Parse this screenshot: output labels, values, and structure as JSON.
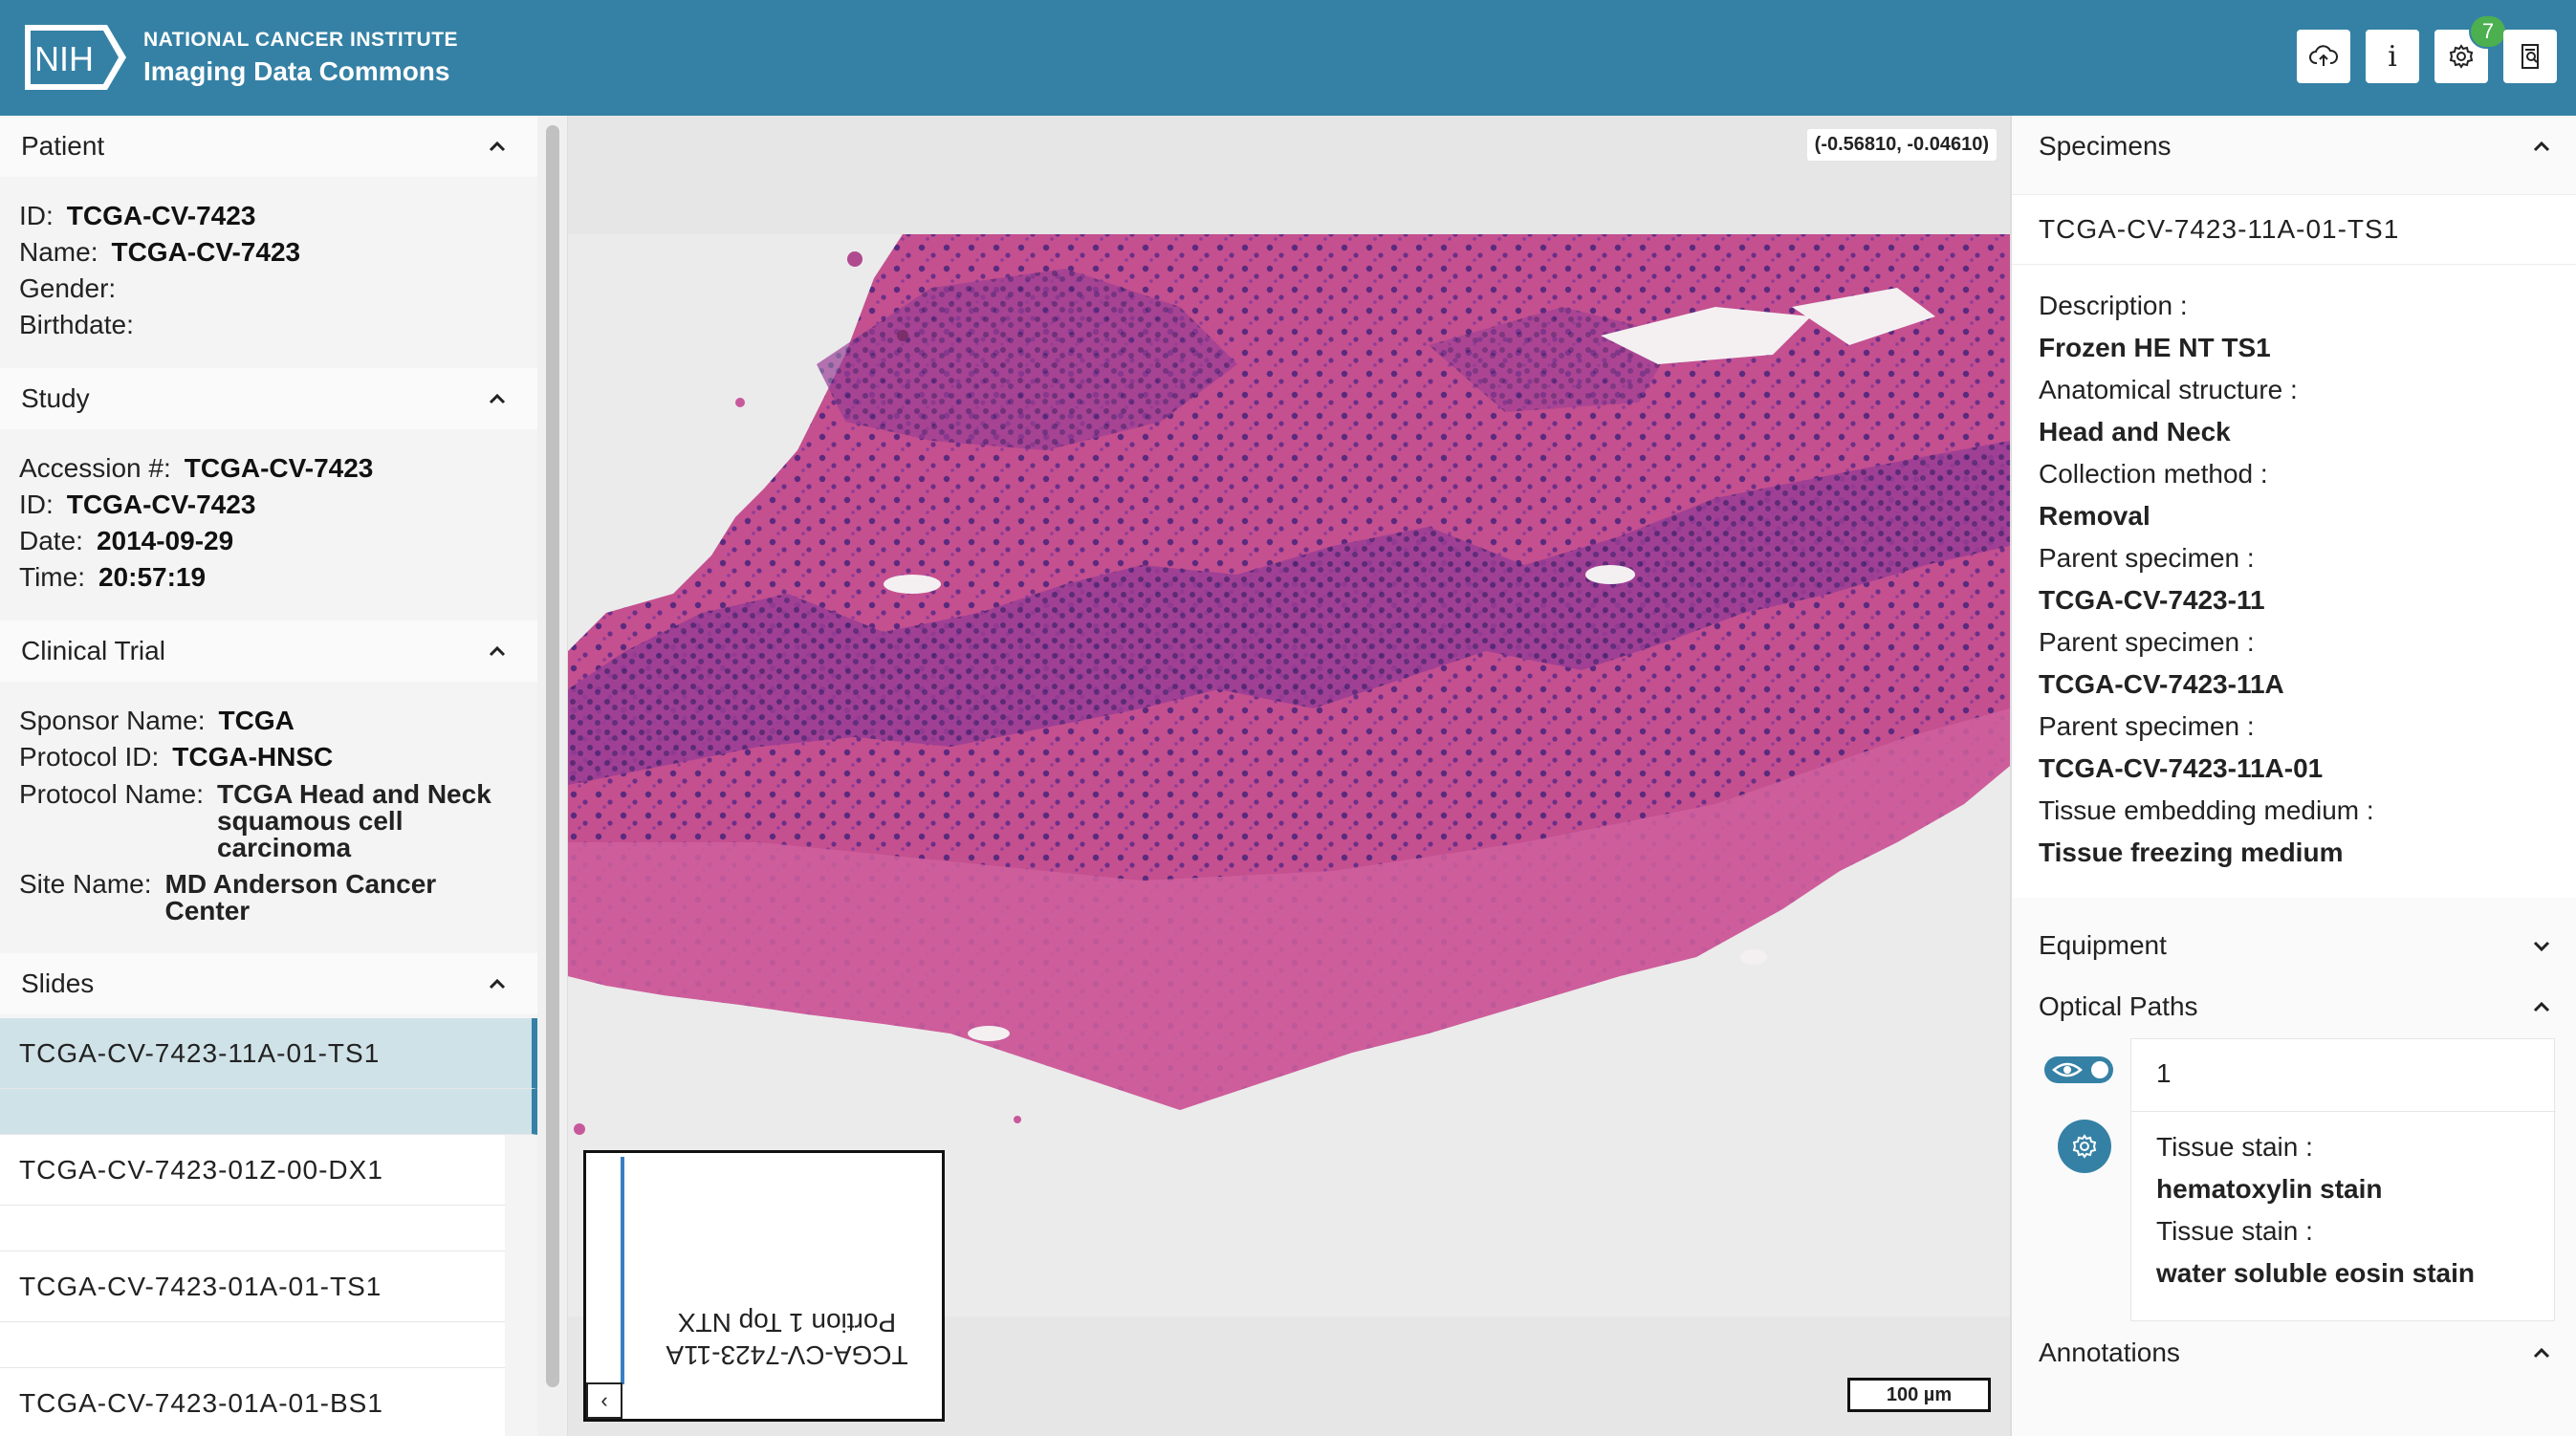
{
  "header": {
    "logo_text": "NIH",
    "org": "NATIONAL CANCER INSTITUTE",
    "app": "Imaging Data Commons",
    "badge_count": "7",
    "info_label": "i",
    "colors": {
      "brand": "#3581a5",
      "badge": "#4caf50"
    }
  },
  "patient": {
    "title": "Patient",
    "id_label": "ID",
    "id": "TCGA-CV-7423",
    "name_label": "Name",
    "name": "TCGA-CV-7423",
    "gender_label": "Gender",
    "gender": "",
    "birthdate_label": "Birthdate",
    "birthdate": ""
  },
  "study": {
    "title": "Study",
    "accession_label": "Accession #",
    "accession": "TCGA-CV-7423",
    "id_label": "ID",
    "id": "TCGA-CV-7423",
    "date_label": "Date",
    "date": "2014-09-29",
    "time_label": "Time",
    "time": "20:57:19"
  },
  "clinical_trial": {
    "title": "Clinical Trial",
    "sponsor_label": "Sponsor Name",
    "sponsor": "TCGA",
    "protocol_id_label": "Protocol ID",
    "protocol_id": "TCGA-HNSC",
    "protocol_name_label": "Protocol Name",
    "protocol_name": "TCGA Head and Neck squamous cell carcinoma",
    "site_label": "Site Name",
    "site": "MD Anderson Cancer Center"
  },
  "slides": {
    "title": "Slides",
    "items": [
      "TCGA-CV-7423-11A-01-TS1",
      "TCGA-CV-7423-01Z-00-DX1",
      "TCGA-CV-7423-01A-01-TS1",
      "TCGA-CV-7423-01A-01-BS1"
    ]
  },
  "viewer": {
    "coords": "(-0.56810, -0.04610)",
    "scale": "100 µm",
    "overview_label_line1": "TCGA-CV-7423-11A",
    "overview_label_line2": "Portion 1 Top NTX",
    "overview_toggle": "‹"
  },
  "specimens": {
    "title": "Specimens",
    "id": "TCGA-CV-7423-11A-01-TS1",
    "description_label": "Description",
    "description": "Frozen HE NT TS1",
    "anatomical_label": "Anatomical structure",
    "anatomical": "Head and Neck",
    "collection_label": "Collection method",
    "collection": "Removal",
    "parent_label": "Parent specimen",
    "parent1": "TCGA-CV-7423-11",
    "parent2": "TCGA-CV-7423-11A",
    "parent3": "TCGA-CV-7423-11A-01",
    "embedding_label": "Tissue embedding medium",
    "embedding": "Tissue freezing medium"
  },
  "equipment": {
    "title": "Equipment"
  },
  "optical_paths": {
    "title": "Optical Paths",
    "path_id": "1",
    "stain_label": "Tissue stain",
    "stain1": "hematoxylin stain",
    "stain2": "water soluble eosin stain"
  },
  "annotations": {
    "title": "Annotations"
  }
}
